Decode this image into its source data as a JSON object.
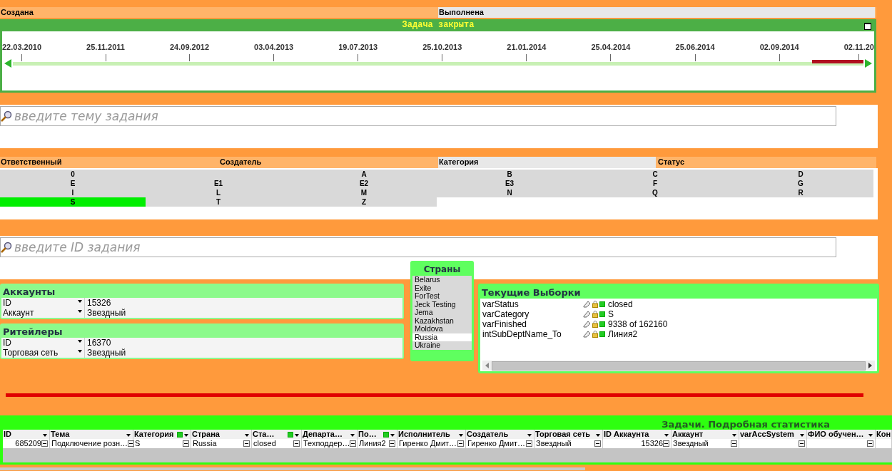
{
  "date_headers": [
    {
      "label": "Создана",
      "selected": false
    },
    {
      "label": "Выполнена",
      "selected": true
    }
  ],
  "timeline": {
    "title": "Задача закрыта",
    "ticks": [
      "22.03.2010",
      "25.11.2011",
      "24.09.2012",
      "03.04.2013",
      "19.07.2013",
      "25.10.2013",
      "21.01.2014",
      "25.04.2014",
      "25.06.2014",
      "02.09.2014",
      "02.11.20"
    ],
    "selection": {
      "level": 0.055
    }
  },
  "topic_search": {
    "placeholder": "введите тему задания"
  },
  "filter_headers": [
    {
      "label": "Ответственный",
      "selected": false
    },
    {
      "label": "Создатель",
      "selected": false
    },
    {
      "label": "Категория",
      "selected": true
    },
    {
      "label": "Статус",
      "selected": false
    }
  ],
  "category_values": [
    [
      {
        "kind": "value",
        "text": "0",
        "selected": false
      },
      {
        "kind": "blank"
      },
      {
        "kind": "value",
        "text": "A",
        "selected": false
      },
      {
        "kind": "value",
        "text": "B",
        "selected": false
      },
      {
        "kind": "value",
        "text": "C",
        "selected": false
      },
      {
        "kind": "value",
        "text": "D",
        "selected": false
      }
    ],
    [
      {
        "kind": "value",
        "text": "E",
        "selected": false
      },
      {
        "kind": "value",
        "text": "E1",
        "selected": false
      },
      {
        "kind": "value",
        "text": "E2",
        "selected": false
      },
      {
        "kind": "value",
        "text": "E3",
        "selected": false
      },
      {
        "kind": "value",
        "text": "F",
        "selected": false
      },
      {
        "kind": "value",
        "text": "G",
        "selected": false
      }
    ],
    [
      {
        "kind": "value",
        "text": "I",
        "selected": false
      },
      {
        "kind": "value",
        "text": "L",
        "selected": false
      },
      {
        "kind": "value",
        "text": "M",
        "selected": false
      },
      {
        "kind": "value",
        "text": "N",
        "selected": false
      },
      {
        "kind": "value",
        "text": "Q",
        "selected": false
      },
      {
        "kind": "value",
        "text": "R",
        "selected": false
      }
    ],
    [
      {
        "kind": "value",
        "text": "S",
        "selected": true
      },
      {
        "kind": "value",
        "text": "T",
        "selected": false
      },
      {
        "kind": "value",
        "text": "Z",
        "selected": false
      }
    ]
  ],
  "id_search": {
    "placeholder": "введите ID задания"
  },
  "accounts": {
    "title": "Аккаунты",
    "rows": [
      {
        "field": "ID",
        "value": "15326"
      },
      {
        "field": "Аккаунт",
        "value": "Звездный"
      }
    ]
  },
  "retailers": {
    "title": "Ритейлеры",
    "rows": [
      {
        "field": "ID",
        "value": "16370"
      },
      {
        "field": "Торговая сеть",
        "value": "Звездный"
      }
    ]
  },
  "countries": {
    "title": "Страны",
    "items": [
      {
        "label": "Belarus",
        "selected": false
      },
      {
        "label": "Exite",
        "selected": false
      },
      {
        "label": "ForTest",
        "selected": false
      },
      {
        "label": "Jeck Testing",
        "selected": false
      },
      {
        "label": "Jema",
        "selected": false
      },
      {
        "label": "Kazakhstan",
        "selected": false
      },
      {
        "label": "Moldova",
        "selected": false
      },
      {
        "label": "Russia",
        "selected": true
      },
      {
        "label": "Ukraine",
        "selected": false
      }
    ]
  },
  "current_selections": {
    "title": "Текущие Выборки",
    "rows": [
      {
        "field": "varStatus",
        "value": "closed"
      },
      {
        "field": "varCategory",
        "value": "S"
      },
      {
        "field": "varFinished",
        "value": "9338 of 162160"
      },
      {
        "field": "intSubDeptName_To",
        "value": "Линия2"
      }
    ]
  },
  "tasks_table": {
    "title": "Задачи. Подробная статистика",
    "columns": [
      {
        "label": "ID",
        "filtered": false
      },
      {
        "label": "Тема",
        "filtered": false
      },
      {
        "label": "Категория",
        "filtered": true
      },
      {
        "label": "Страна",
        "filtered": false
      },
      {
        "label": "Ста…",
        "filtered": true
      },
      {
        "label": "Департа…",
        "filtered": false
      },
      {
        "label": "По…",
        "filtered": true
      },
      {
        "label": "Исполнитель",
        "filtered": false
      },
      {
        "label": "Создатель",
        "filtered": false
      },
      {
        "label": "Торговая сеть",
        "filtered": false
      },
      {
        "label": "ID Аккаунта",
        "filtered": false
      },
      {
        "label": "Аккаунт",
        "filtered": false
      },
      {
        "label": "varAccSystem",
        "filtered": false
      },
      {
        "label": "ФИО обучен…",
        "filtered": false
      },
      {
        "label": "Кон",
        "filtered": false
      }
    ],
    "rows": [
      {
        "cells": [
          "685209",
          "Подключение розн…",
          "S",
          "Russia",
          "closed",
          "Техподдер…",
          "Линия2",
          "Гиренко Дмит…",
          "Гиренко Дмит…",
          "Звездный",
          "15326",
          "Звездный"
        ]
      }
    ]
  }
}
